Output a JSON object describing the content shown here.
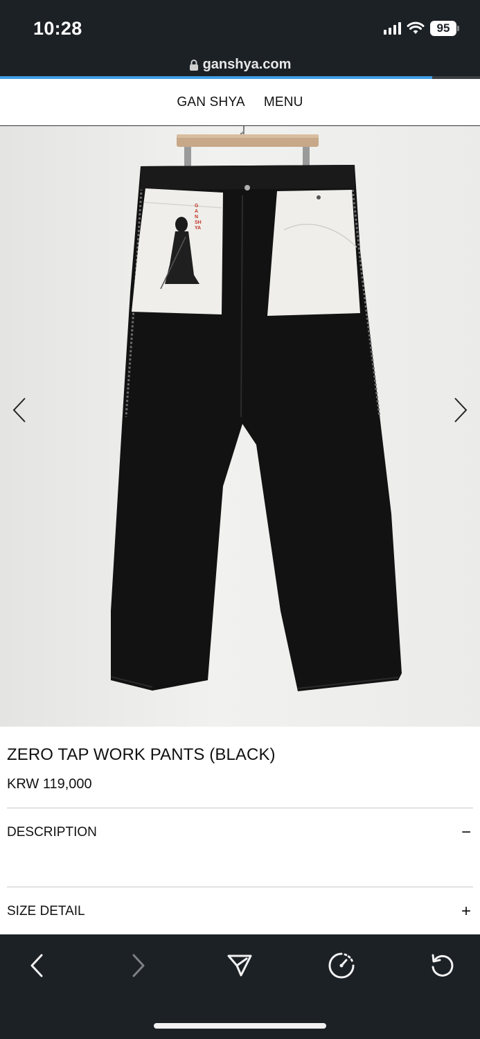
{
  "status_bar": {
    "time": "10:28",
    "battery": "95"
  },
  "url_bar": {
    "domain": "ganshya.com",
    "load_progress": 0.9
  },
  "site_header": {
    "brand": "GAN SHYA",
    "menu": "MENU"
  },
  "product": {
    "title": "ZERO TAP WORK PANTS (BLACK)",
    "price": "KRW 119,000",
    "image_pocket_text": "GAN SHYA"
  },
  "accordions": [
    {
      "label": "DESCRIPTION",
      "toggle": "−",
      "expanded": true
    },
    {
      "label": "SIZE DETAIL",
      "toggle": "+",
      "expanded": false
    }
  ],
  "toolbar": {
    "icons": [
      "back-icon",
      "forward-icon",
      "share-icon",
      "speed-dial-icon",
      "reload-icon"
    ]
  },
  "colors": {
    "chrome_bg": "#1c2126",
    "progress": "#3e9fe6",
    "pants": "#111111",
    "pocket_lining": "#efeeea"
  }
}
